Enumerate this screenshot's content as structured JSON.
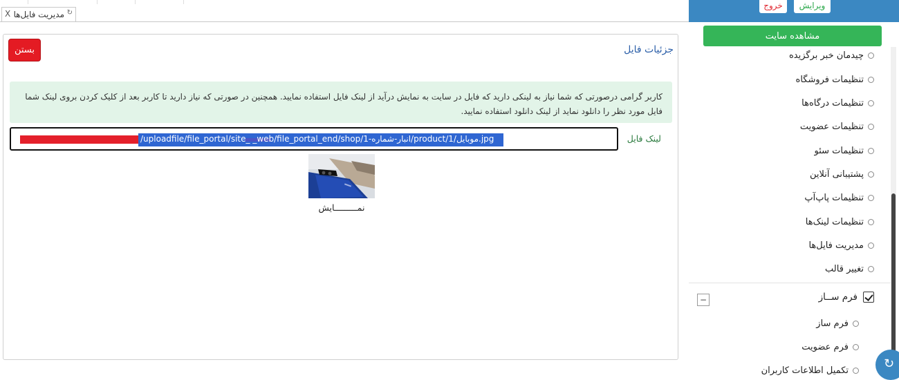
{
  "tab": {
    "label": "مدیریت فایل‌ها",
    "close": "X"
  },
  "panel": {
    "title": "جزئیات فایل",
    "close_button": "بستن",
    "alert_text": "کاربر گرامی درصورتی که شما نیاز به لینکی دارید که فایل در سایت به نمایش درآید از لینک فایل استفاده نمایید. همچنین در صورتی که نیاز دارید تا کاربر بعد از کلیک کردن بروی لینک شما فایل مورد نظر را دانلود نماید از لینک دانلود استفاده نمایید.",
    "file_link_label": "لینک فایل",
    "file_link_value": "/uploadfile/file_portal/site_      _web/file_portal_end/shop/1-انبار-شماره/product/1/موبایل.jpg",
    "preview_caption": "نمـــــــــایش"
  },
  "sidebar": {
    "edit_button": "ویرایش",
    "exit_button": "خروج",
    "view_site_button": "مشاهده سایت",
    "items": [
      {
        "label": "چیدمان خبر برگزیده"
      },
      {
        "label": "تنظیمات فروشگاه"
      },
      {
        "label": "تنظیمات درگاه‌ها"
      },
      {
        "label": "تنظیمات عضویت"
      },
      {
        "label": "تنظیمات سئو"
      },
      {
        "label": "پشتیبانی آنلاین"
      },
      {
        "label": "تنظیمات پاپ‌آپ"
      },
      {
        "label": "تنظیمات لینک‌ها"
      },
      {
        "label": "مدیریت فایل‌ها"
      },
      {
        "label": "تغییر قالب"
      }
    ],
    "section_title": "فرم ســاز",
    "collapse_symbol": "−",
    "section_items": [
      {
        "label": "فرم ساز"
      },
      {
        "label": "فرم عضویت"
      },
      {
        "label": "تکمیل اطلاعات کاربران"
      }
    ]
  },
  "colors": {
    "accent": "#3b88c2",
    "danger": "#e41b23",
    "success": "#35b558",
    "alert_bg": "#e2f4e8"
  },
  "icons": {
    "refresh": "refresh-icon",
    "fab": "refresh-icon"
  }
}
